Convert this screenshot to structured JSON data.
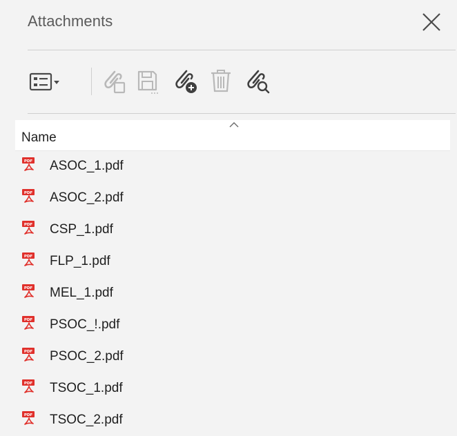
{
  "panel": {
    "title": "Attachments"
  },
  "toolbar": {
    "buttons": [
      {
        "icon": "view-options-icon",
        "state": "enabled"
      },
      {
        "icon": "open-attachment-icon",
        "state": "disabled"
      },
      {
        "icon": "save-attachment-icon",
        "state": "disabled"
      },
      {
        "icon": "add-attachment-icon",
        "state": "enabled"
      },
      {
        "icon": "delete-attachment-icon",
        "state": "disabled"
      },
      {
        "icon": "search-attachment-icon",
        "state": "enabled"
      }
    ]
  },
  "list": {
    "column_header": "Name",
    "sort": "ascending",
    "files": [
      {
        "name": "ASOC_1.pdf",
        "icon": "pdf-file-icon"
      },
      {
        "name": "ASOC_2.pdf",
        "icon": "pdf-file-icon"
      },
      {
        "name": "CSP_1.pdf",
        "icon": "pdf-file-icon"
      },
      {
        "name": "FLP_1.pdf",
        "icon": "pdf-file-icon"
      },
      {
        "name": "MEL_1.pdf",
        "icon": "pdf-file-icon"
      },
      {
        "name": "PSOC_!.pdf",
        "icon": "pdf-file-icon"
      },
      {
        "name": "PSOC_2.pdf",
        "icon": "pdf-file-icon"
      },
      {
        "name": "TSOC_1.pdf",
        "icon": "pdf-file-icon"
      },
      {
        "name": "TSOC_2.pdf",
        "icon": "pdf-file-icon"
      }
    ]
  },
  "colors": {
    "background": "#f3f3f3",
    "enabled_icon": "#4a4a4a",
    "disabled_icon": "#b8b8b8",
    "pdf_red": "#e0302b"
  }
}
